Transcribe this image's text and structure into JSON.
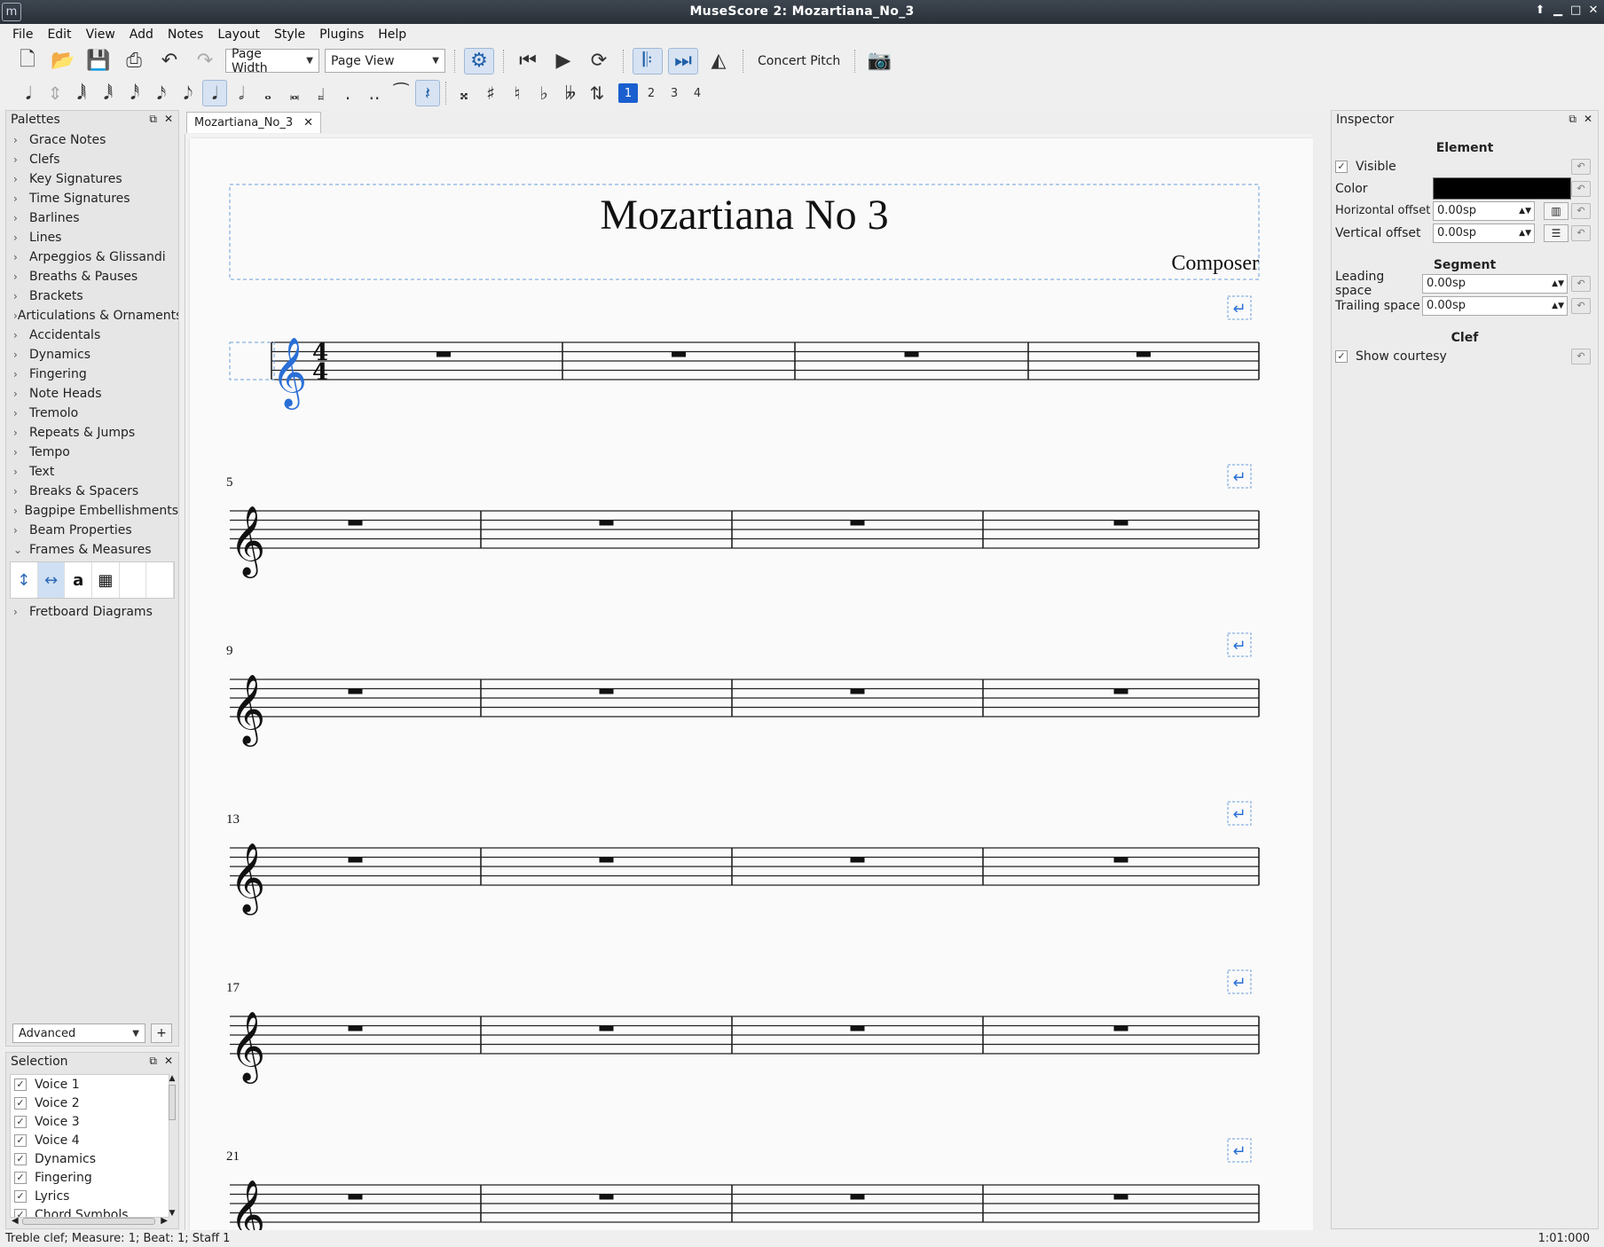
{
  "window": {
    "app_icon": "m",
    "title": "MuseScore 2: Mozartiana_No_3"
  },
  "menu": [
    "File",
    "Edit",
    "View",
    "Add",
    "Notes",
    "Layout",
    "Style",
    "Plugins",
    "Help"
  ],
  "toolbar": {
    "zoom_select": "Page Width",
    "view_select": "Page View",
    "concert_pitch": "Concert Pitch"
  },
  "voices": [
    "1",
    "2",
    "3",
    "4"
  ],
  "palettes": {
    "title": "Palettes",
    "items": [
      "Grace Notes",
      "Clefs",
      "Key Signatures",
      "Time Signatures",
      "Barlines",
      "Lines",
      "Arpeggios & Glissandi",
      "Breaths & Pauses",
      "Brackets",
      "Articulations & Ornaments",
      "Accidentals",
      "Dynamics",
      "Fingering",
      "Note Heads",
      "Tremolo",
      "Repeats & Jumps",
      "Tempo",
      "Text",
      "Breaks & Spacers",
      "Bagpipe Embellishments",
      "Beam Properties"
    ],
    "expanded": "Frames & Measures",
    "after": "Fretboard Diagrams",
    "frame_text_cell": "a",
    "workspace": "Advanced",
    "add": "+"
  },
  "selection": {
    "title": "Selection",
    "items": [
      "Voice 1",
      "Voice 2",
      "Voice 3",
      "Voice 4",
      "Dynamics",
      "Fingering",
      "Lyrics",
      "Chord Symbols"
    ]
  },
  "tab": {
    "label": "Mozartiana_No_3"
  },
  "score": {
    "title": "Mozartiana No 3",
    "composer": "Composer",
    "time_signature": {
      "top": "4",
      "bottom": "4"
    },
    "systems": [
      {
        "measure_number": ""
      },
      {
        "measure_number": "5"
      },
      {
        "measure_number": "9"
      },
      {
        "measure_number": "13"
      },
      {
        "measure_number": "17"
      },
      {
        "measure_number": "21"
      }
    ]
  },
  "inspector": {
    "title": "Inspector",
    "element": {
      "title": "Element",
      "visible_label": "Visible",
      "color_label": "Color",
      "color_value": "#000000",
      "h_offset_label": "Horizontal offset",
      "h_offset": "0.00sp",
      "v_offset_label": "Vertical offset",
      "v_offset": "0.00sp"
    },
    "segment": {
      "title": "Segment",
      "leading_label": "Leading space",
      "leading": "0.00sp",
      "trailing_label": "Trailing space",
      "trailing": "0.00sp"
    },
    "clef": {
      "title": "Clef",
      "courtesy_label": "Show courtesy"
    }
  },
  "status": {
    "left": "Treble clef;  Measure: 1; Beat: 1; Staff 1",
    "right": "1:01:000"
  },
  "colors": {
    "accent": "#1a5fd0",
    "selected_clef": "#2a6fd6",
    "frame_outline": "#6a9fd8"
  }
}
